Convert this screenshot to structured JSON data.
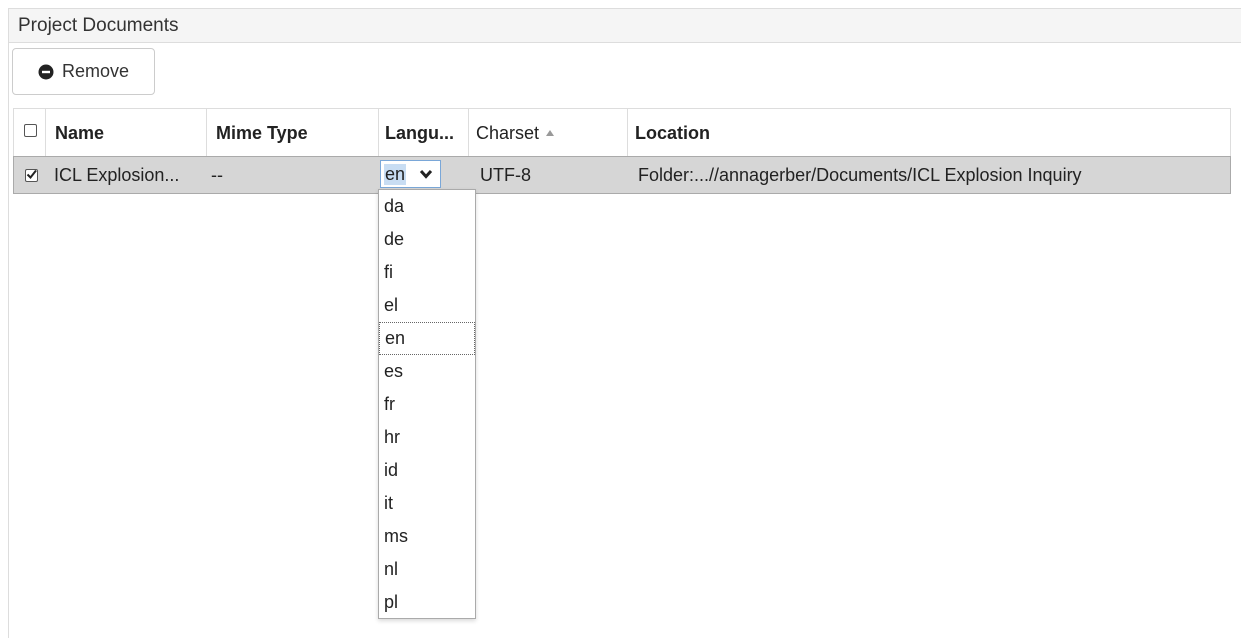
{
  "panel": {
    "title": "Project Documents"
  },
  "toolbar": {
    "remove_label": "Remove"
  },
  "table": {
    "columns": {
      "name": "Name",
      "mime_type": "Mime Type",
      "language": "Langu...",
      "charset": "Charset",
      "location": "Location"
    },
    "sort": {
      "column": "charset",
      "direction": "ascending"
    },
    "rows": [
      {
        "checked": true,
        "name": "ICL Explosion...",
        "mime_type": "--",
        "language": "en",
        "charset": "UTF-8",
        "location": "Folder:...//annagerber/Documents/ICL Explosion Inquiry"
      }
    ]
  },
  "language_dropdown": {
    "selected": "en",
    "options": [
      "da",
      "de",
      "fi",
      "el",
      "en",
      "es",
      "fr",
      "hr",
      "id",
      "it",
      "ms",
      "nl",
      "pl"
    ]
  },
  "icons": {
    "remove": "minus-circle-icon",
    "sort": "sort-ascending-icon",
    "dropdown": "chevron-down-icon"
  },
  "colors": {
    "selected_row": "#d6d6d6",
    "text_highlight": "#c8ddf3",
    "select_border": "#7aa7d8"
  }
}
